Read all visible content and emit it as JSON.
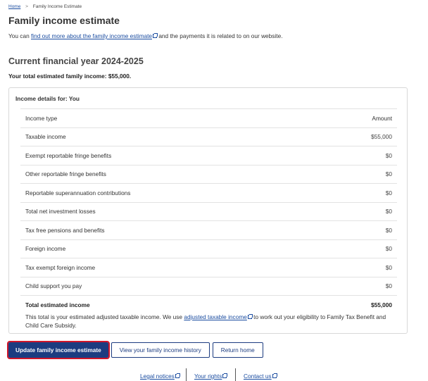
{
  "breadcrumb": {
    "home": "Home",
    "separator": ">",
    "current": "Family Income Estimate"
  },
  "page": {
    "title": "Family income estimate",
    "intro_prefix": "You can ",
    "intro_link": "find out more about the family income estimate",
    "intro_suffix": " and the payments it is related to on our website."
  },
  "year": {
    "heading": "Current financial year 2024-2025",
    "total_summary": "Your total estimated family income: $55,000."
  },
  "income_card": {
    "title": "Income details for: You",
    "header": {
      "type": "Income type",
      "amount": "Amount"
    },
    "rows": [
      {
        "type": "Taxable income",
        "amount": "$55,000"
      },
      {
        "type": "Exempt reportable fringe benefits",
        "amount": "$0"
      },
      {
        "type": "Other reportable fringe benefits",
        "amount": "$0"
      },
      {
        "type": "Reportable superannuation contributions",
        "amount": "$0"
      },
      {
        "type": "Total net investment losses",
        "amount": "$0"
      },
      {
        "type": "Tax free pensions and benefits",
        "amount": "$0"
      },
      {
        "type": "Foreign income",
        "amount": "$0"
      },
      {
        "type": "Tax exempt foreign income",
        "amount": "$0"
      },
      {
        "type": "Child support you pay",
        "amount": "$0"
      }
    ],
    "total": {
      "label": "Total estimated income",
      "amount": "$55,000"
    },
    "note_prefix": "This total is your estimated adjusted taxable income. We use ",
    "note_link": "adjusted taxable income",
    "note_suffix": " to work out your eligibility to Family Tax Benefit and Child Care Subsidy."
  },
  "actions": {
    "update": "Update family income estimate",
    "history": "View your family income history",
    "home": "Return home"
  },
  "footer": {
    "legal": "Legal notices",
    "rights": "Your rights",
    "contact": "Contact us"
  },
  "colors": {
    "primary": "#1c3c80",
    "link": "#1a4ca0",
    "highlight": "#d0162a"
  }
}
